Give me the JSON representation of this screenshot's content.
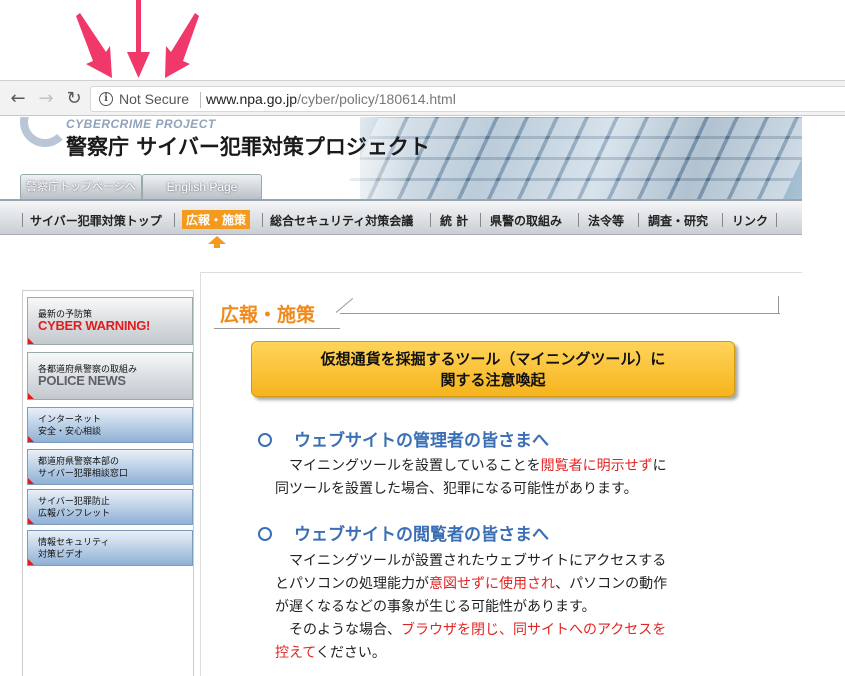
{
  "browser": {
    "security_label": "Not Secure",
    "url_host": "www.npa.go.jp",
    "url_path": "/cyber/policy/180614.html"
  },
  "header": {
    "project_en": "CYBERCRIME PROJECT",
    "project_jp": "警察庁 サイバー犯罪対策プロジェクト",
    "tabs": [
      {
        "label": "警察庁トップページへ"
      },
      {
        "label": "English Page"
      }
    ]
  },
  "mainnav": {
    "items": [
      {
        "label": "サイバー犯罪対策トップ"
      },
      {
        "label": "広報・施策"
      },
      {
        "label": "総合セキュリティ対策会議"
      },
      {
        "label": "統 計"
      },
      {
        "label": "県警の取組み"
      },
      {
        "label": "法令等"
      },
      {
        "label": "調査・研究"
      },
      {
        "label": "リンク"
      }
    ]
  },
  "sidebar": {
    "items": [
      {
        "small": "最新の予防策",
        "big": "CYBER WARNING!"
      },
      {
        "small": "各都道府県警察の取組み",
        "big": "POLICE NEWS"
      },
      {
        "line1": "インターネット",
        "line2": "安全・安心相談"
      },
      {
        "line1": "都道府県警察本部の",
        "line2": "サイバー犯罪相談窓口"
      },
      {
        "line1": "サイバー犯罪防止",
        "line2": "広報パンフレット"
      },
      {
        "line1": "情報セキュリティ",
        "line2": "対策ビデオ"
      }
    ]
  },
  "content": {
    "section_title": "広報・施策",
    "notice_line1": "仮想通貨を採掘するツール（マイニングツール）に",
    "notice_line2": "関する注意喚起",
    "admins": {
      "heading": "ウェブサイトの管理者の皆さまへ",
      "p1_a": "マイニングツールを設置していることを",
      "p1_red": "閲覧者に明示せず",
      "p1_b": "に",
      "p1_c": "同ツールを設置した場合、犯罪になる可能性があります。"
    },
    "viewers": {
      "heading": "ウェブサイトの閲覧者の皆さまへ",
      "p1_a": "マイニングツールが設置されたウェブサイトにアクセスする",
      "p1_b": "とパソコンの処理能力が",
      "p1_red": "意図せずに使用され",
      "p1_c": "、パソコンの動作",
      "p1_d": "が遅くなるなどの事象が生じる可能性があります。",
      "p2_a": "そのような場合、",
      "p2_red1": "ブラウザを閉じ、同サイトへのアクセスを",
      "p2_red2": "控えて",
      "p2_b": "ください。"
    }
  },
  "colors": {
    "accent_orange": "#f08a1c",
    "heading_blue": "#3a6fb5",
    "warning_red": "#e22424",
    "arrow_pink": "#f0386b"
  }
}
